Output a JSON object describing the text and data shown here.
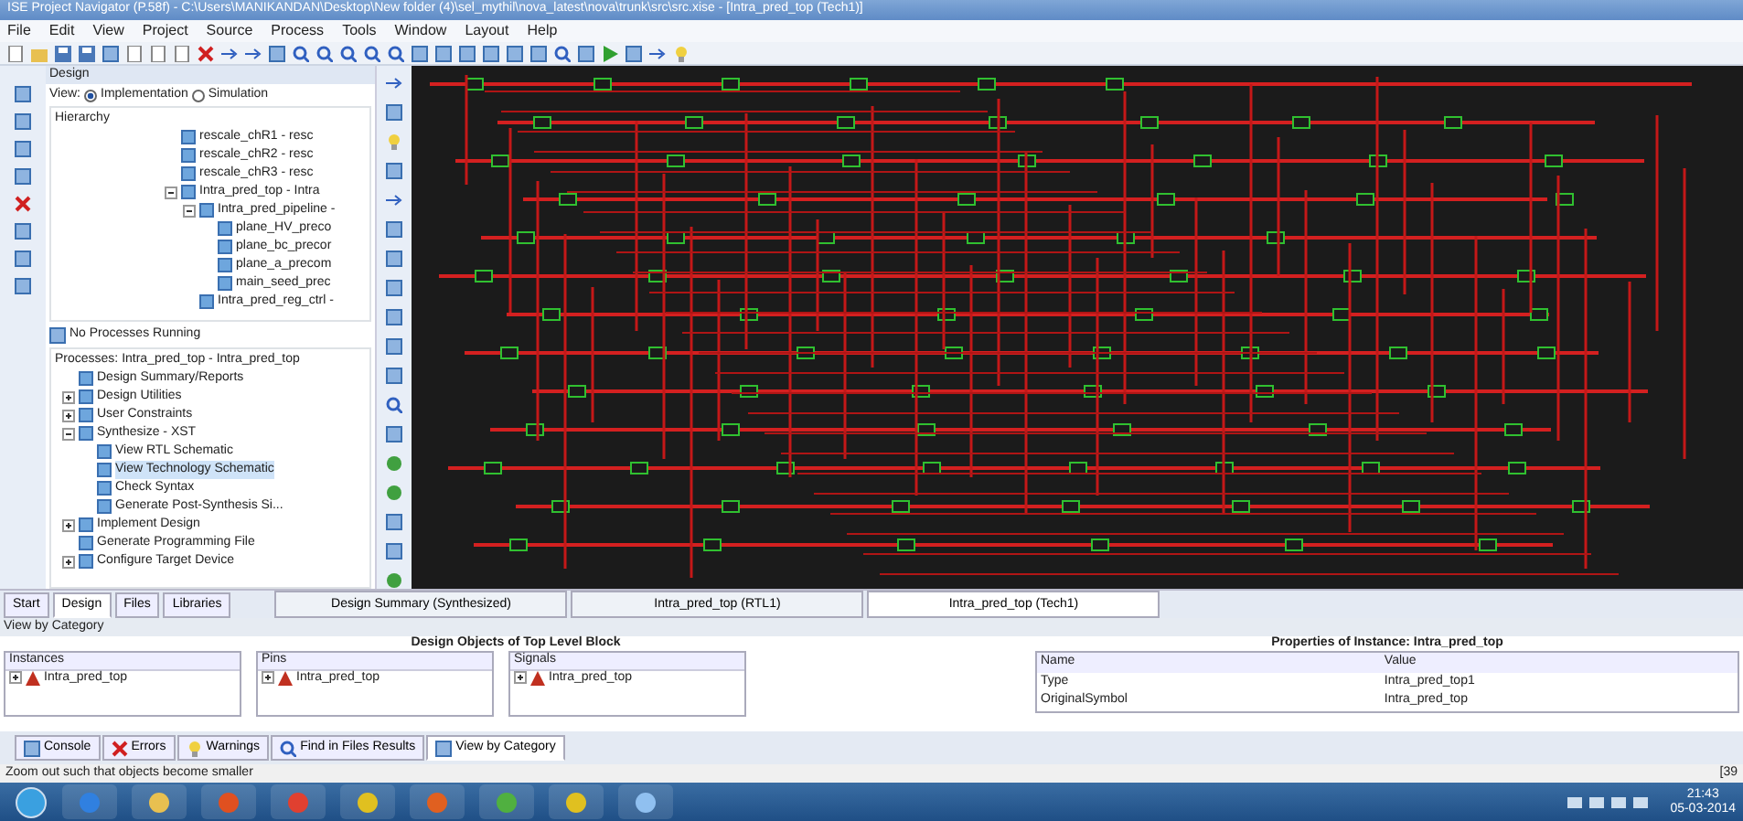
{
  "window": {
    "title": "ISE Project Navigator (P.58f) - C:\\Users\\MANIKANDAN\\Desktop\\New folder (4)\\sel_mythil\\nova_latest\\nova\\trunk\\src\\src.xise - [Intra_pred_top (Tech1)]"
  },
  "menu": [
    "File",
    "Edit",
    "View",
    "Project",
    "Source",
    "Process",
    "Tools",
    "Window",
    "Layout",
    "Help"
  ],
  "design_panel": {
    "title": "Design",
    "view_label": "View:",
    "views": [
      {
        "label": "Implementation",
        "selected": true
      },
      {
        "label": "Simulation",
        "selected": false
      }
    ],
    "hierarchy_title": "Hierarchy",
    "hierarchy": [
      {
        "label": "rescale_chR1 - resc"
      },
      {
        "label": "rescale_chR2 - resc"
      },
      {
        "label": "rescale_chR3 - resc"
      },
      {
        "label": "Intra_pred_top - Intra",
        "expanded": true,
        "children": [
          {
            "label": "Intra_pred_pipeline -",
            "expanded": true,
            "children": [
              {
                "label": "plane_HV_preco"
              },
              {
                "label": "plane_bc_precor"
              },
              {
                "label": "plane_a_precom"
              },
              {
                "label": "main_seed_prec"
              }
            ]
          },
          {
            "label": "Intra_pred_reg_ctrl -"
          }
        ]
      }
    ]
  },
  "process_status": "No Processes Running",
  "processes": {
    "title": "Processes: Intra_pred_top - Intra_pred_top",
    "items": [
      {
        "label": "Design Summary/Reports"
      },
      {
        "label": "Design Utilities",
        "expanded": false
      },
      {
        "label": "User Constraints",
        "expanded": false
      },
      {
        "label": "Synthesize - XST",
        "expanded": true,
        "children": [
          {
            "label": "View RTL Schematic"
          },
          {
            "label": "View Technology Schematic",
            "selected": true
          },
          {
            "label": "Check Syntax"
          },
          {
            "label": "Generate Post-Synthesis Si..."
          }
        ]
      },
      {
        "label": "Implement Design",
        "expanded": false
      },
      {
        "label": "Generate Programming File"
      },
      {
        "label": "Configure Target Device",
        "expanded": false
      }
    ]
  },
  "panel_tabs": [
    {
      "label": "Start",
      "selected": false
    },
    {
      "label": "Design",
      "selected": true
    },
    {
      "label": "Files",
      "selected": false
    },
    {
      "label": "Libraries",
      "selected": false
    }
  ],
  "document_tabs": [
    {
      "label": "Design Summary (Synthesized)",
      "selected": false
    },
    {
      "label": "Intra_pred_top (RTL1)",
      "selected": false
    },
    {
      "label": "Intra_pred_top (Tech1)",
      "selected": true
    }
  ],
  "view_by_category": {
    "title": "View by Category",
    "objects_title": "Design Objects of Top Level Block",
    "properties_title": "Properties of Instance: Intra_pred_top",
    "lists": [
      {
        "header": "Instances",
        "item": "Intra_pred_top"
      },
      {
        "header": "Pins",
        "item": "Intra_pred_top"
      },
      {
        "header": "Signals",
        "item": "Intra_pred_top"
      }
    ],
    "properties": {
      "columns": [
        "Name",
        "Value"
      ],
      "rows": [
        [
          "Type",
          "Intra_pred_top1"
        ],
        [
          "OriginalSymbol",
          "Intra_pred_top"
        ]
      ]
    }
  },
  "bottom_tabs": [
    {
      "label": "Console",
      "selected": false
    },
    {
      "label": "Errors",
      "selected": false
    },
    {
      "label": "Warnings",
      "selected": false
    },
    {
      "label": "Find in Files Results",
      "selected": false
    },
    {
      "label": "View by Category",
      "selected": true
    }
  ],
  "status_bar": {
    "message": "Zoom out such that objects become smaller",
    "coords": "[39"
  },
  "taskbar": {
    "time": "21:43",
    "date": "05-03-2014"
  }
}
